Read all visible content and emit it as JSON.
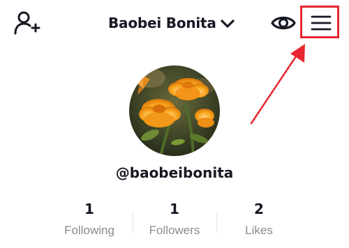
{
  "header": {
    "title": "Baobei Bonita",
    "add_friend_icon": "add-person-icon",
    "account_switch_icon": "chevron-down-icon",
    "view_icon": "eye-icon",
    "menu_icon": "hamburger-menu-icon"
  },
  "annotation": {
    "highlight_color": "#e8262f"
  },
  "profile": {
    "avatar_description_icon": "orange-flowers-avatar",
    "username": "@baobeibonita"
  },
  "stats": [
    {
      "value": "1",
      "label": "Following"
    },
    {
      "value": "1",
      "label": "Followers"
    },
    {
      "value": "2",
      "label": "Likes"
    }
  ],
  "colors": {
    "text": "#161823",
    "label": "#8a8b91",
    "divider": "#e3e3e4"
  }
}
